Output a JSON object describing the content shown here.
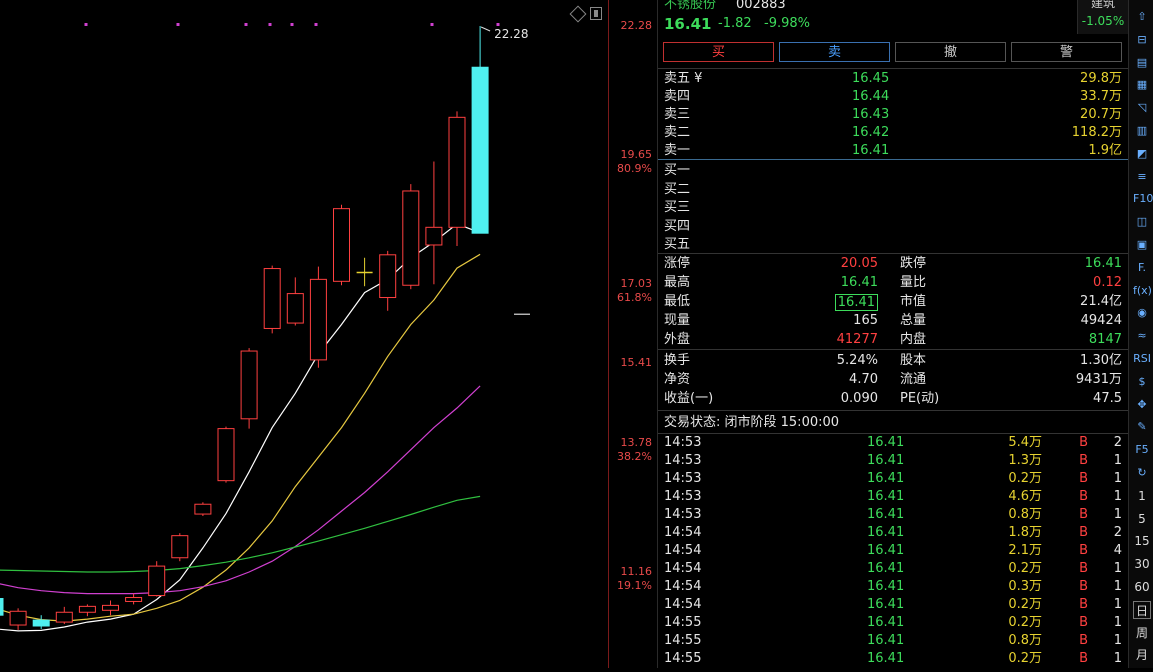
{
  "colors": {
    "up": "#ff4040",
    "down": "#3ddc5b",
    "cyan": "#4ff0f0",
    "flat": "#e6d230"
  },
  "stock": {
    "name": "不锈股份",
    "code": "002883",
    "price": "16.41",
    "change": "-1.82",
    "pct": "-9.98%"
  },
  "corner": {
    "label": "建筑",
    "pct": "-1.05%"
  },
  "trade_buttons": [
    "买",
    "卖",
    "撤",
    "警"
  ],
  "sell_orders": [
    {
      "label": "卖五 ¥",
      "price": "16.45",
      "vol": "29.8万"
    },
    {
      "label": "卖四",
      "price": "16.44",
      "vol": "33.7万"
    },
    {
      "label": "卖三",
      "price": "16.43",
      "vol": "20.7万"
    },
    {
      "label": "卖二",
      "price": "16.42",
      "vol": "118.2万"
    },
    {
      "label": "卖一",
      "price": "16.41",
      "vol": "1.9亿"
    }
  ],
  "buy_orders": [
    {
      "label": "买一"
    },
    {
      "label": "买二"
    },
    {
      "label": "买三"
    },
    {
      "label": "买四"
    },
    {
      "label": "买五"
    }
  ],
  "stats": [
    {
      "l1": "涨停",
      "v1": "20.05",
      "l2": "跌停",
      "v2": "16.41"
    },
    {
      "l1": "最高",
      "v1": "16.41",
      "l2": "量比",
      "v2": "0.12"
    },
    {
      "l1": "最低",
      "v1": "16.41",
      "l2": "市值",
      "v2": "21.4亿"
    },
    {
      "l1": "现量",
      "v1": "165",
      "l2": "总量",
      "v2": "49424"
    },
    {
      "l1": "外盘",
      "v1": "41277",
      "l2": "内盘",
      "v2": "8147"
    },
    {
      "l1": "换手",
      "v1": "5.24%",
      "l2": "股本",
      "v2": "1.30亿"
    },
    {
      "l1": "净资",
      "v1": "4.70",
      "l2": "流通",
      "v2": "9431万"
    },
    {
      "l1": "收益(一)",
      "v1": "0.090",
      "l2": "PE(动)",
      "v2": "47.5"
    }
  ],
  "status_line": "交易状态: 闭市阶段 15:00:00",
  "ticks": [
    {
      "time": "14:53",
      "price": "16.41",
      "vol": "5.4万",
      "side": "B",
      "n": "2"
    },
    {
      "time": "14:53",
      "price": "16.41",
      "vol": "1.3万",
      "side": "B",
      "n": "1"
    },
    {
      "time": "14:53",
      "price": "16.41",
      "vol": "0.2万",
      "side": "B",
      "n": "1"
    },
    {
      "time": "14:53",
      "price": "16.41",
      "vol": "4.6万",
      "side": "B",
      "n": "1"
    },
    {
      "time": "14:53",
      "price": "16.41",
      "vol": "0.8万",
      "side": "B",
      "n": "1"
    },
    {
      "time": "14:54",
      "price": "16.41",
      "vol": "1.8万",
      "side": "B",
      "n": "2"
    },
    {
      "time": "14:54",
      "price": "16.41",
      "vol": "2.1万",
      "side": "B",
      "n": "4"
    },
    {
      "time": "14:54",
      "price": "16.41",
      "vol": "0.2万",
      "side": "B",
      "n": "1"
    },
    {
      "time": "14:54",
      "price": "16.41",
      "vol": "0.3万",
      "side": "B",
      "n": "1"
    },
    {
      "time": "14:54",
      "price": "16.41",
      "vol": "0.2万",
      "side": "B",
      "n": "1"
    },
    {
      "time": "14:55",
      "price": "16.41",
      "vol": "0.2万",
      "side": "B",
      "n": "1"
    },
    {
      "time": "14:55",
      "price": "16.41",
      "vol": "0.8万",
      "side": "B",
      "n": "1"
    },
    {
      "time": "14:55",
      "price": "16.41",
      "vol": "0.2万",
      "side": "B",
      "n": "1"
    }
  ],
  "axis_labels": [
    {
      "price": "22.28",
      "pct": ""
    },
    {
      "price": "19.65",
      "pct": "80.9%"
    },
    {
      "price": "17.03",
      "pct": "61.8%"
    },
    {
      "price": "15.41",
      "pct": ""
    },
    {
      "price": "13.78",
      "pct": "38.2%"
    },
    {
      "price": "11.16",
      "pct": "19.1%"
    }
  ],
  "chart": {
    "high_marker": "22.28"
  },
  "candles": [
    {
      "o": 10.28,
      "h": 10.72,
      "l": 10.05,
      "c": 10.62,
      "f": "down"
    },
    {
      "o": 10.08,
      "h": 10.42,
      "l": 9.98,
      "c": 10.36,
      "f": "up"
    },
    {
      "o": 10.18,
      "h": 10.28,
      "l": 10.0,
      "c": 10.06,
      "f": "down"
    },
    {
      "o": 10.14,
      "h": 10.45,
      "l": 10.1,
      "c": 10.34,
      "f": "up"
    },
    {
      "o": 10.34,
      "h": 10.5,
      "l": 10.26,
      "c": 10.46,
      "f": "up"
    },
    {
      "o": 10.38,
      "h": 10.58,
      "l": 10.28,
      "c": 10.48,
      "f": "up"
    },
    {
      "o": 10.56,
      "h": 10.72,
      "l": 10.5,
      "c": 10.64,
      "f": "up"
    },
    {
      "o": 10.68,
      "h": 11.38,
      "l": 10.66,
      "c": 11.28,
      "f": "up"
    },
    {
      "o": 11.45,
      "h": 11.95,
      "l": 11.38,
      "c": 11.9,
      "f": "up"
    },
    {
      "o": 12.34,
      "h": 12.58,
      "l": 12.3,
      "c": 12.54,
      "f": "up"
    },
    {
      "o": 13.02,
      "h": 14.12,
      "l": 12.98,
      "c": 14.08,
      "f": "up"
    },
    {
      "o": 14.28,
      "h": 15.72,
      "l": 14.08,
      "c": 15.66,
      "f": "up"
    },
    {
      "o": 16.12,
      "h": 17.4,
      "l": 16.02,
      "c": 17.34,
      "f": "up"
    },
    {
      "o": 16.23,
      "h": 17.16,
      "l": 16.18,
      "c": 16.83,
      "f": "up"
    },
    {
      "o": 15.48,
      "h": 17.38,
      "l": 15.32,
      "c": 17.12,
      "f": "up"
    },
    {
      "o": 17.08,
      "h": 18.64,
      "l": 17.0,
      "c": 18.56,
      "f": "up"
    },
    {
      "o": 17.26,
      "h": 17.56,
      "l": 16.98,
      "c": 17.26,
      "f": "flat"
    },
    {
      "o": 16.75,
      "h": 17.7,
      "l": 16.48,
      "c": 17.62,
      "f": "up"
    },
    {
      "o": 17.0,
      "h": 19.06,
      "l": 16.92,
      "c": 18.92,
      "f": "up"
    },
    {
      "o": 17.82,
      "h": 19.52,
      "l": 17.02,
      "c": 18.18,
      "f": "up"
    },
    {
      "o": 18.18,
      "h": 20.54,
      "l": 17.8,
      "c": 20.42,
      "f": "up"
    },
    {
      "o": 21.44,
      "h": 22.28,
      "l": 18.12,
      "c": 18.06,
      "f": "cyan"
    }
  ],
  "ma": [
    {
      "color": "#ffffff",
      "values": [
        10.0,
        9.96,
        9.97,
        10.04,
        10.14,
        10.2,
        10.3,
        10.6,
        11.0,
        11.65,
        12.35,
        13.2,
        14.1,
        14.8,
        15.6,
        16.2,
        16.85,
        17.12,
        17.56,
        17.88,
        18.25,
        18.07
      ]
    },
    {
      "color": "#e6c840",
      "values": [
        10.42,
        10.28,
        10.19,
        10.16,
        10.2,
        10.26,
        10.3,
        10.42,
        10.58,
        10.85,
        11.2,
        11.65,
        12.2,
        12.9,
        13.5,
        14.1,
        14.8,
        15.55,
        16.2,
        16.7,
        17.35,
        17.63
      ]
    },
    {
      "color": "#d040d0",
      "values": [
        10.94,
        10.84,
        10.78,
        10.74,
        10.72,
        10.72,
        10.72,
        10.74,
        10.78,
        10.86,
        10.98,
        11.16,
        11.38,
        11.68,
        12.02,
        12.4,
        12.78,
        13.2,
        13.65,
        14.1,
        14.5,
        14.95
      ]
    },
    {
      "color": "#30c040",
      "values": [
        11.2,
        11.19,
        11.18,
        11.17,
        11.16,
        11.16,
        11.17,
        11.19,
        11.23,
        11.29,
        11.36,
        11.45,
        11.55,
        11.67,
        11.79,
        11.92,
        12.05,
        12.19,
        12.33,
        12.48,
        12.62,
        12.7
      ]
    }
  ],
  "right_toolbar": [
    "⇧",
    "⊟",
    "▤",
    "▦",
    "◹",
    "▥",
    "◩",
    "≡",
    "F10",
    "◫",
    "▣",
    "F.",
    "f(x)",
    "◉",
    "≈",
    "RSI",
    "$",
    "✥",
    "✎",
    "F5",
    "↻",
    "1",
    "5",
    "15",
    "30",
    "60",
    "日",
    "周",
    "月"
  ]
}
